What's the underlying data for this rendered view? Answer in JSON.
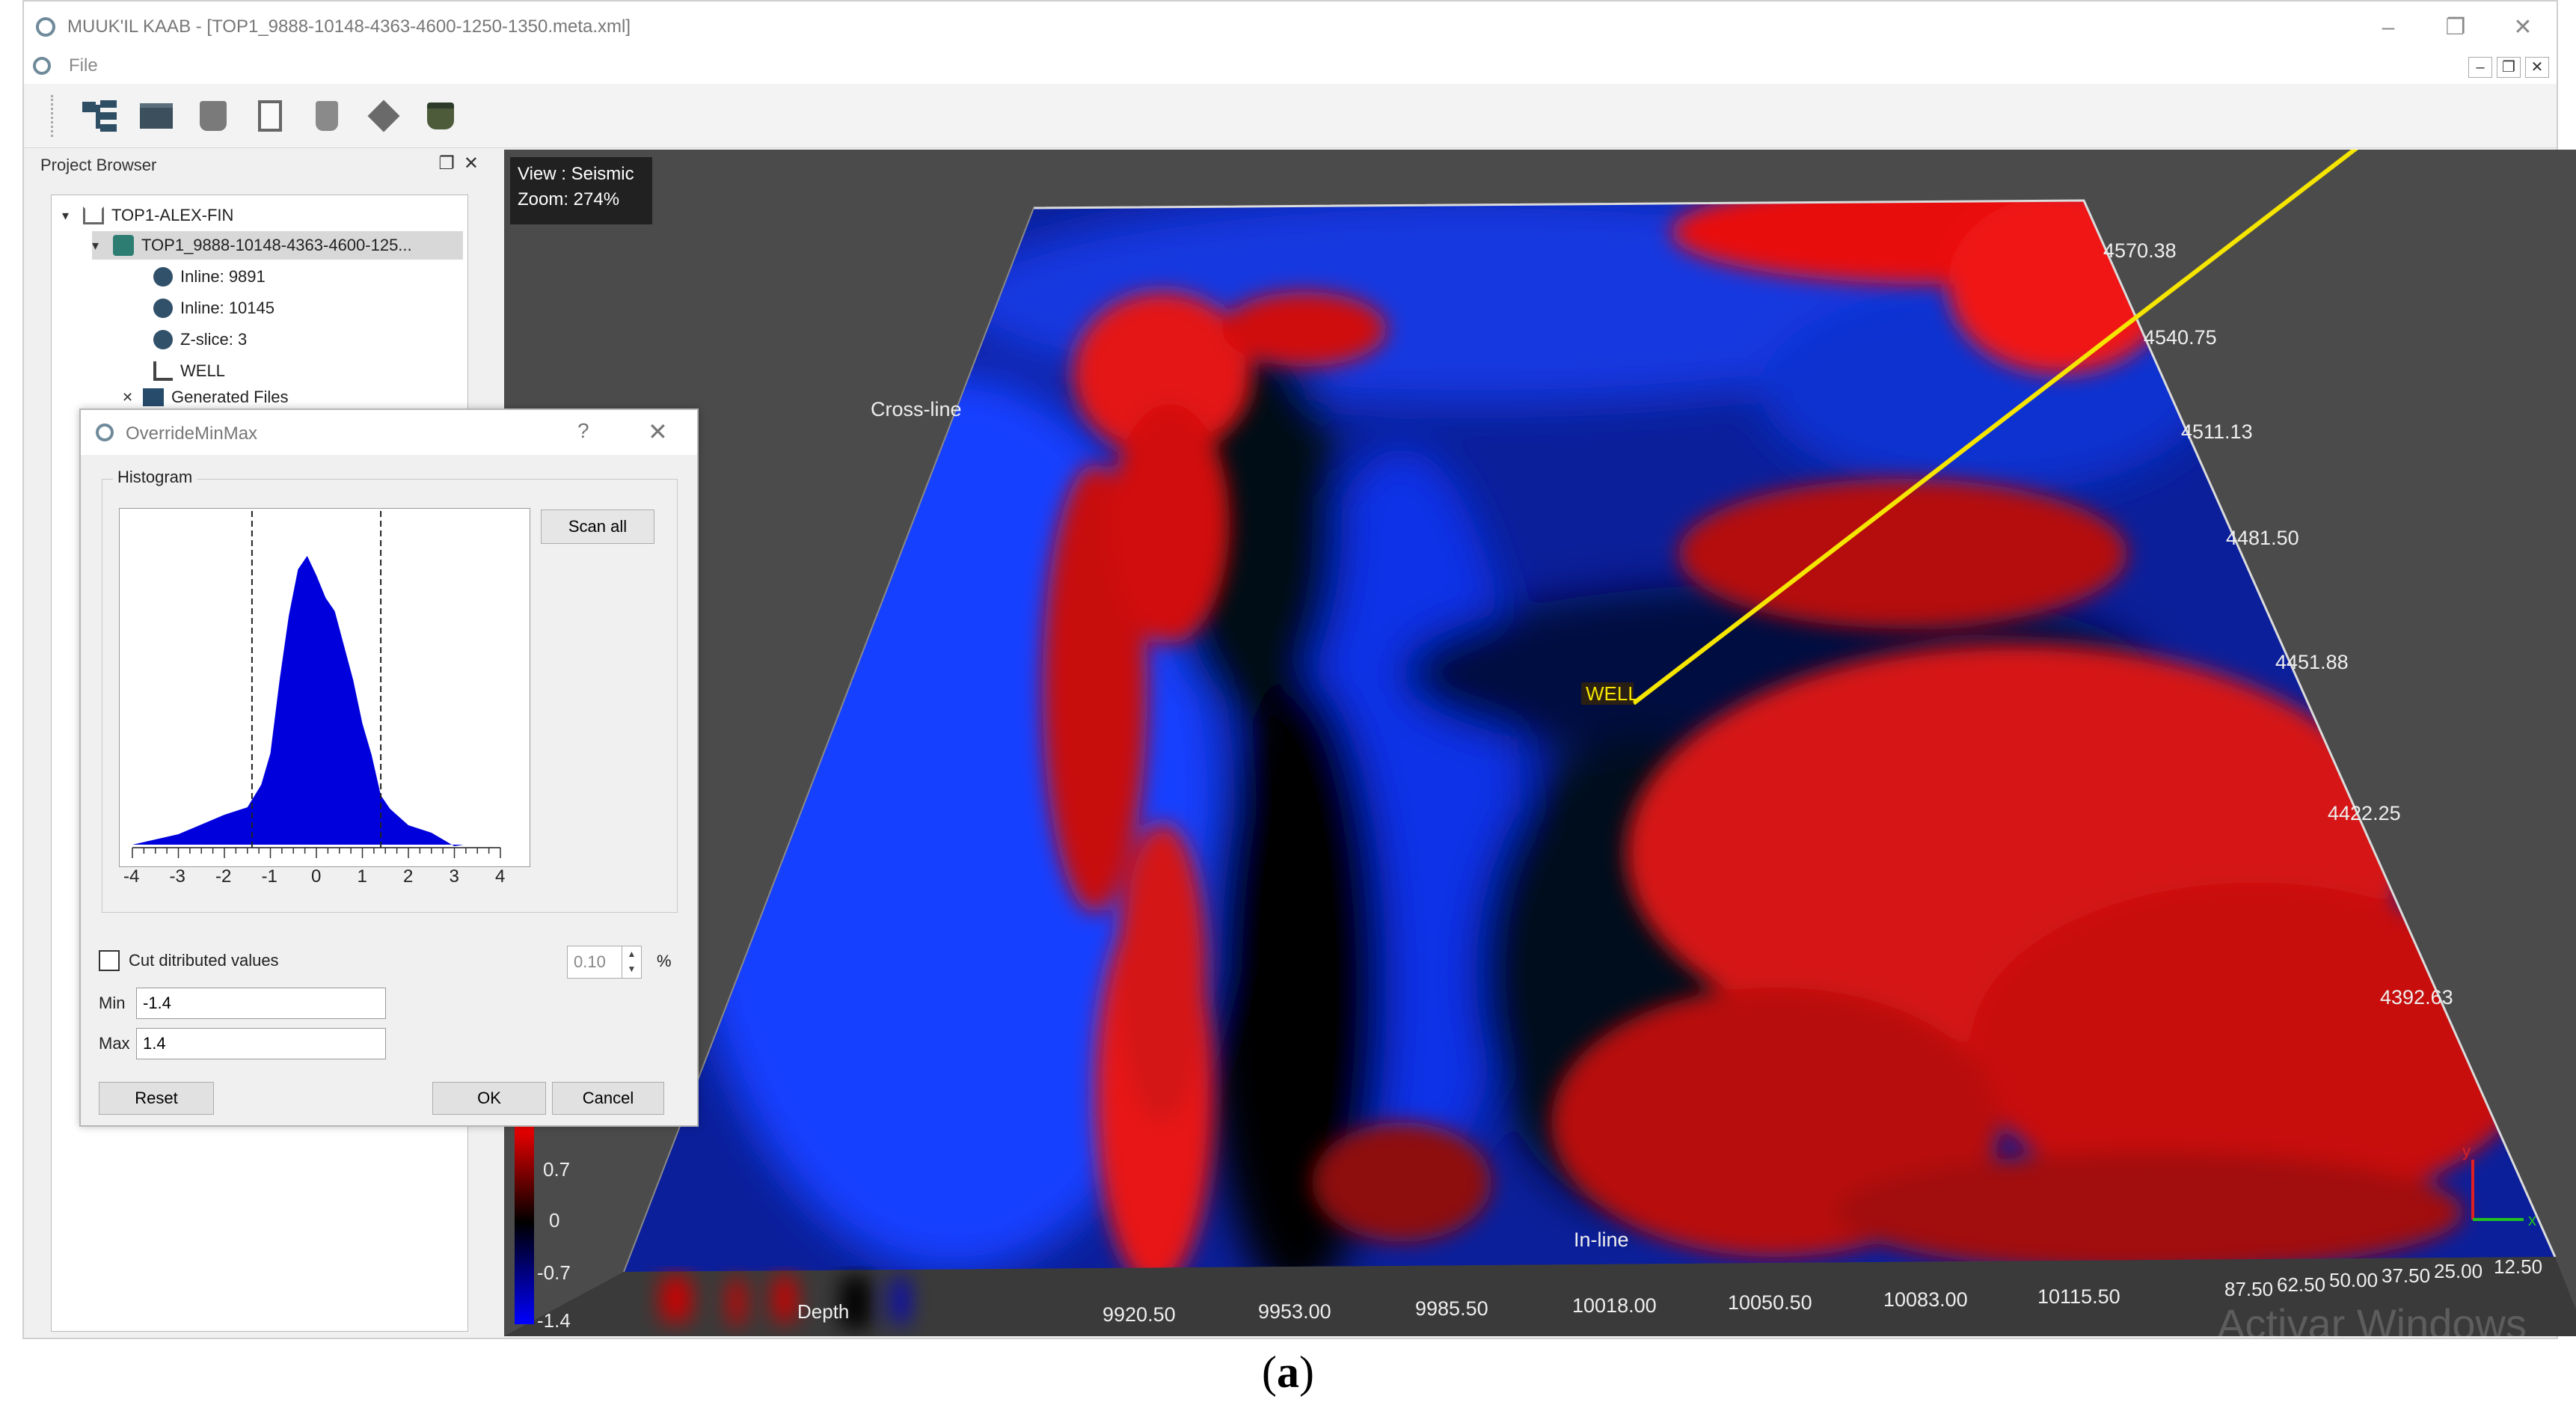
{
  "window": {
    "title": "MUUK'IL KAAB - [TOP1_9888-10148-4363-4600-1250-1350.meta.xml]",
    "controls": [
      "–",
      "❐",
      "✕"
    ]
  },
  "menubar": {
    "file": "File",
    "mdi_controls": [
      "–",
      "❐",
      "✕"
    ]
  },
  "toolbar": {
    "icons": [
      "tree-icon",
      "folder-icon",
      "bucket-icon",
      "document-icon",
      "fill-icon",
      "cube-icon",
      "paint-pot-icon"
    ]
  },
  "project_browser": {
    "title": "Project Browser",
    "controls": "❐✕",
    "items": [
      {
        "label": "TOP1-ALEX-FIN",
        "chevron": "▾"
      },
      {
        "label": "TOP1_9888-10148-4363-4600-125...",
        "chevron": "▾"
      },
      {
        "label": "Inline: 9891"
      },
      {
        "label": "Inline: 10145"
      },
      {
        "label": "Z-slice: 3"
      },
      {
        "label": "WELL"
      },
      {
        "label": "Generated Files",
        "chevron": "✕"
      }
    ]
  },
  "viewport": {
    "view_line": "View : Seismic",
    "zoom_line": "Zoom: 274%",
    "cross_line_label": "Cross-line",
    "inline_label": "In-line",
    "depth_label": "Depth",
    "well_label": "WELL",
    "crossline_ticks": [
      "4570.38",
      "4540.75",
      "4511.13",
      "4481.50",
      "4451.88",
      "4422.25",
      "4392.63"
    ],
    "inline_ticks": [
      "9920.50",
      "9953.00",
      "9985.50",
      "10018.00",
      "10050.50",
      "10083.00",
      "10115.50"
    ],
    "corner_ticks": [
      "87.50",
      "62.50",
      "50.00",
      "37.50",
      "25.00",
      "12.50"
    ],
    "colorbar_ticks": [
      "0.7",
      "0",
      "-0.7",
      "-1.4"
    ],
    "axis_x": "x",
    "axis_y": "y",
    "watermark": "Activar Windows"
  },
  "dialog": {
    "title": "OverrideMinMax",
    "help": "?",
    "close": "✕",
    "histogram_group": "Histogram",
    "scan_all": "Scan all",
    "x_ticks": [
      "-4",
      "-3",
      "-2",
      "-1",
      "0",
      "1",
      "2",
      "3",
      "4"
    ],
    "cut_label": "Cut ditributed values",
    "cut_value": "0.10",
    "percent": "%",
    "min_label": "Min",
    "min_value": "-1.4",
    "max_label": "Max",
    "max_value": "1.4",
    "reset": "Reset",
    "ok": "OK",
    "cancel": "Cancel"
  },
  "histogram_data": {
    "x": [
      -4,
      -3,
      -2,
      -1.5,
      -1.2,
      -1,
      -0.8,
      -0.6,
      -0.4,
      -0.2,
      0,
      0.2,
      0.4,
      0.6,
      0.8,
      1,
      1.2,
      1.4,
      1.6,
      2,
      2.5,
      3,
      3.2
    ],
    "y": [
      0,
      0.05,
      0.1,
      0.14,
      0.2,
      0.32,
      0.55,
      0.78,
      0.92,
      0.98,
      0.9,
      0.84,
      0.78,
      0.68,
      0.55,
      0.42,
      0.3,
      0.18,
      0.12,
      0.08,
      0.04,
      0.01,
      0
    ],
    "x_range": [
      -4,
      4
    ],
    "min_marker": -1.4,
    "max_marker": 1.4,
    "fill_color": "#0000dd"
  },
  "caption": {
    "text": "(a)"
  }
}
